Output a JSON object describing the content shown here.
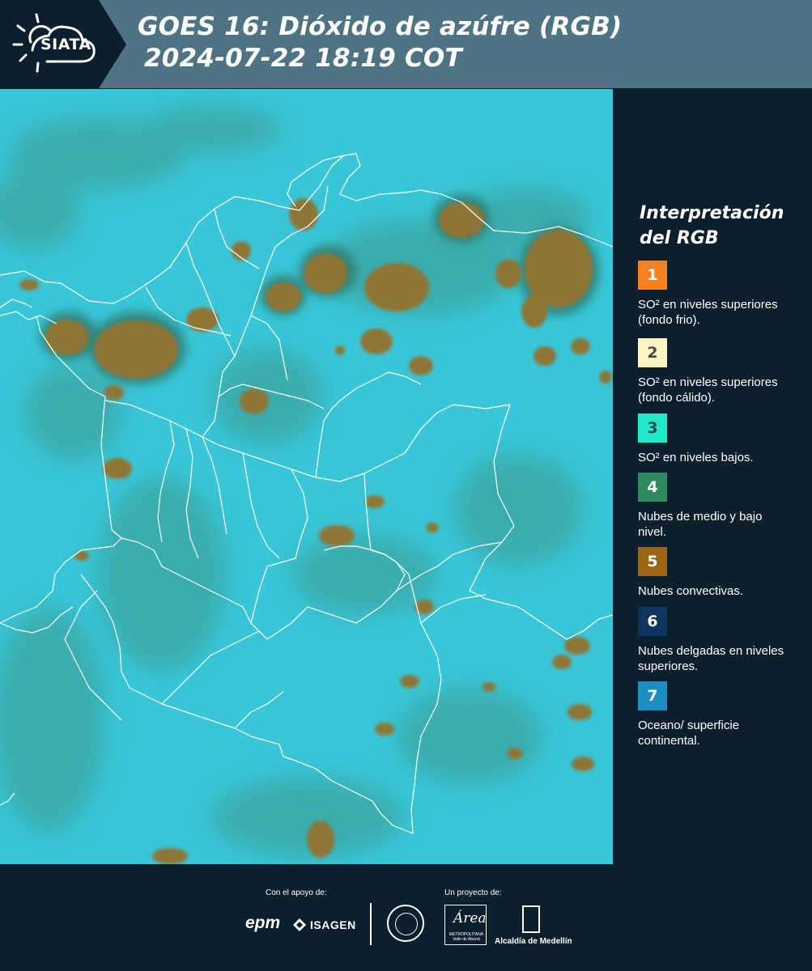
{
  "header": {
    "logo_text": "SIATA",
    "title_line1": "GOES 16: Dióxido de azúfre (RGB)",
    "title_line2": "2024-07-22 18:19 COT"
  },
  "legend": {
    "title": "Interpretación del RGB",
    "items": [
      {
        "number": "1",
        "color": "#f58220",
        "text_color": "#ffffff",
        "description": "SO² en niveles superiores (fondo frio)."
      },
      {
        "number": "2",
        "color": "#fdf6c3",
        "text_color": "#4a4a4a",
        "description": "SO² en niveles superiores (fondo cálido)."
      },
      {
        "number": "3",
        "color": "#20e8c8",
        "text_color": "#2e4a4a",
        "description": "SO² en niveles bajos."
      },
      {
        "number": "4",
        "color": "#2e8b5e",
        "text_color": "#ffffff",
        "description": "Nubes de medio y bajo nivel."
      },
      {
        "number": "5",
        "color": "#9c6510",
        "text_color": "#ffffff",
        "description": "Nubes convectivas."
      },
      {
        "number": "6",
        "color": "#0e3460",
        "text_color": "#ffffff",
        "description": "Nubes delgadas en niveles superiores."
      },
      {
        "number": "7",
        "color": "#1b8fbf",
        "text_color": "#ffffff",
        "description": "Oceano/ superficie continental."
      }
    ]
  },
  "footer": {
    "support_label": "Con el apoyo de:",
    "project_label": "Un proyecto de:",
    "sponsor1": "epm",
    "sponsor2": "ISAGEN",
    "partner_area": "Área",
    "partner_area_sub": "METROPOLITANA Valle de Aburrá",
    "partner_alcaldia": "Alcaldía de Medellín"
  },
  "colors": {
    "header_bg": "#4e7483",
    "panel_bg": "#0c1f2c",
    "map_cyan": "#38c6d8",
    "cloud_brown": "#8f7434",
    "border_white": "#ffffff"
  }
}
